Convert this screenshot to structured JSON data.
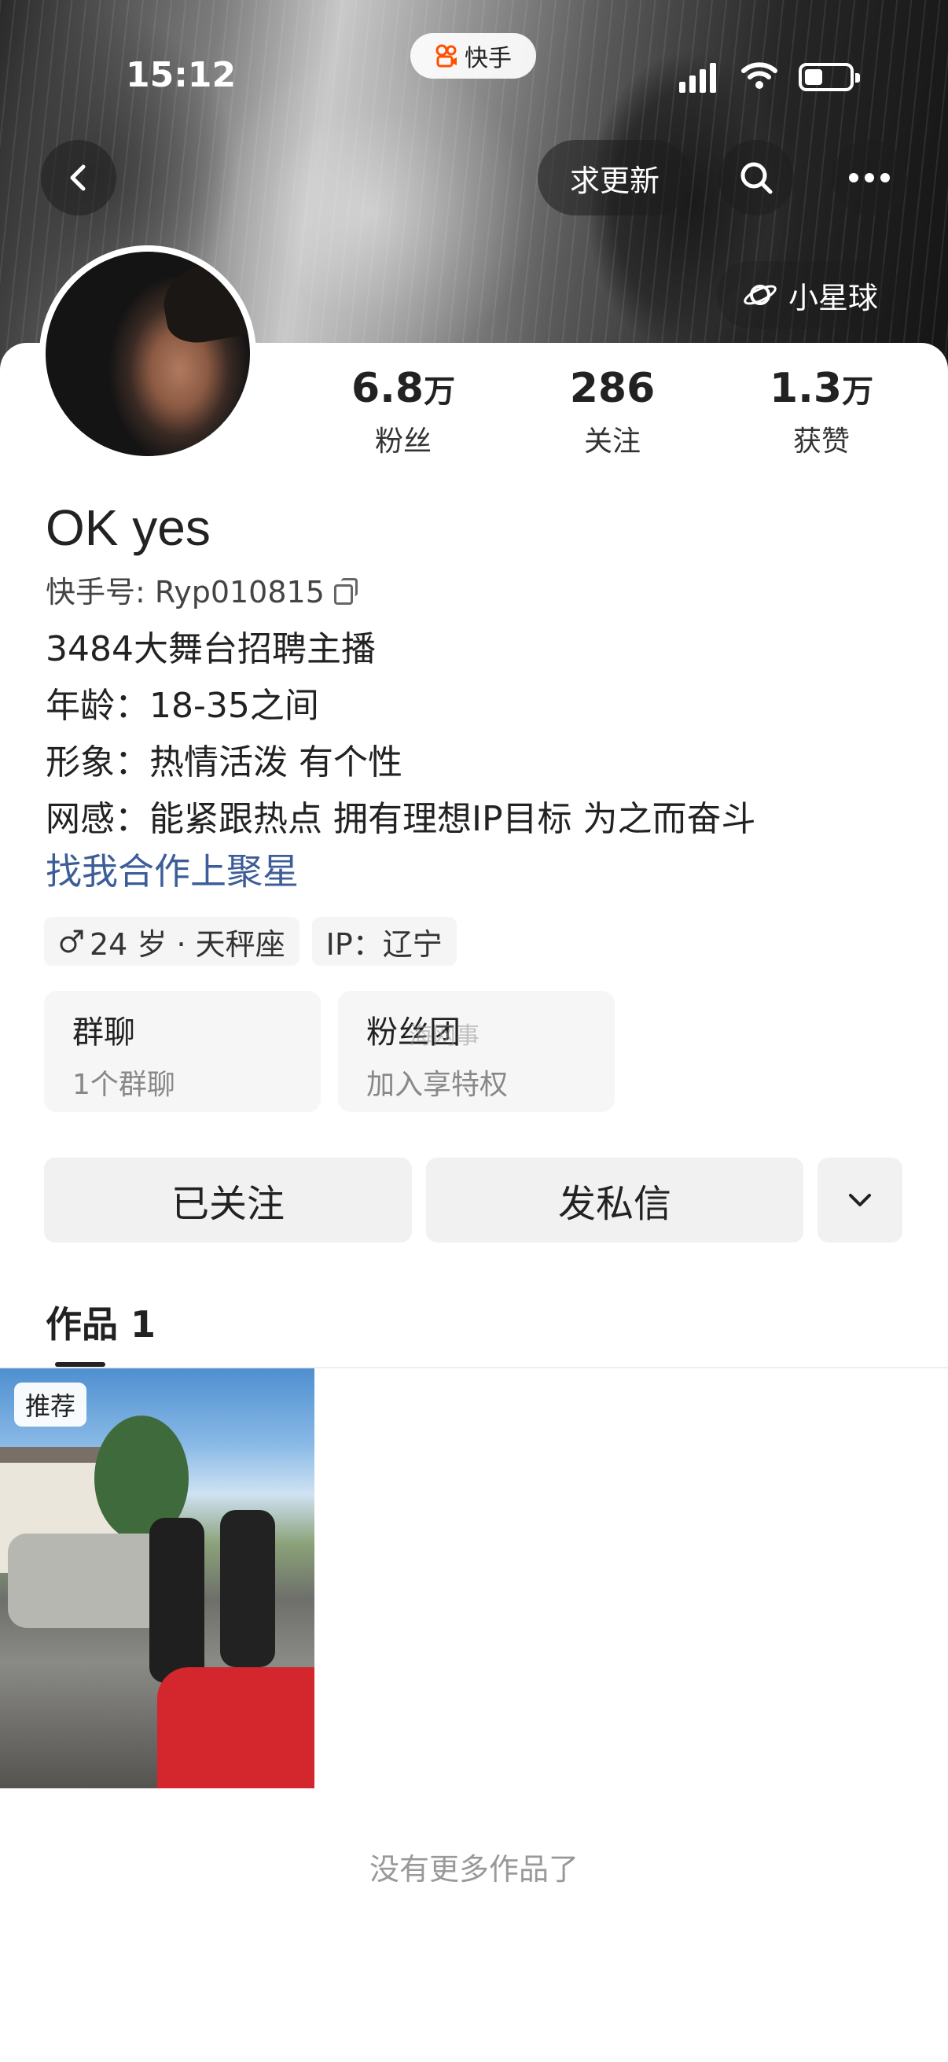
{
  "status_bar": {
    "time": "15:12",
    "app_name": "快手"
  },
  "nav": {
    "back_icon": "chevron-left-icon",
    "update_button": "求更新",
    "search_icon": "search-icon",
    "more_icon": "more-dots-icon",
    "planet_button": "小星球",
    "planet_icon": "planet-icon"
  },
  "profile": {
    "display_name": "OK yes",
    "kuaishou_id": "快手号: Ryp010815",
    "stats": [
      {
        "num": "6.8",
        "unit": "万",
        "label": "粉丝"
      },
      {
        "num": "286",
        "unit": "",
        "label": "关注"
      },
      {
        "num": "1.3",
        "unit": "万",
        "label": "获赞"
      }
    ],
    "bio_lines": [
      "3484大舞台招聘主播",
      "年龄：18-35之间",
      "形象：热情活泼 有个性",
      "网感：能紧跟热点 拥有理想IP目标 为之而奋斗"
    ],
    "link_text": "找我合作上聚星",
    "tags": {
      "age": "24 岁 · 天秤座",
      "ip": "IP：辽宁"
    }
  },
  "groups": [
    {
      "title": "群聊",
      "subtitle": "1个群聊"
    },
    {
      "title": "粉丝团",
      "subtitle": "加入享特权"
    }
  ],
  "watermark": "海网事",
  "actions": {
    "follow": "已关注",
    "message": "发私信",
    "dropdown_icon": "chevron-down-icon"
  },
  "tabs": {
    "works": "作品 1"
  },
  "works": [
    {
      "badge": "推荐"
    }
  ],
  "footer": {
    "no_more": "没有更多作品了"
  }
}
